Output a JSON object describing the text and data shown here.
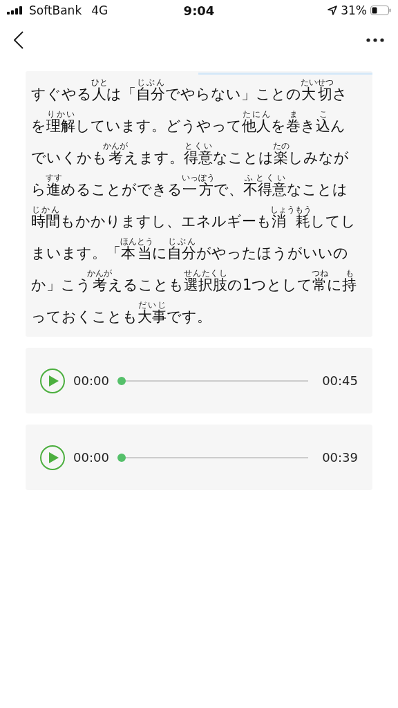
{
  "status_bar": {
    "carrier": "SoftBank",
    "network": "4G",
    "time": "9:04",
    "battery": "31%"
  },
  "passage": {
    "lines": [
      [
        {
          "text": "すぐやる"
        },
        {
          "text": "人",
          "ruby": "ひと"
        },
        {
          "text": "は「"
        },
        {
          "text": "自分",
          "ruby": "じぶん"
        },
        {
          "text": "でやらない」ことの"
        },
        {
          "text": "大切",
          "ruby": "たいせつ"
        },
        {
          "text": "さ"
        }
      ],
      [
        {
          "text": "を"
        },
        {
          "text": "理解",
          "ruby": "りかい"
        },
        {
          "text": "しています。どうやって"
        },
        {
          "text": "他人",
          "ruby": "たにん"
        },
        {
          "text": "を"
        },
        {
          "text": "巻",
          "ruby": "ま"
        },
        {
          "text": "き"
        },
        {
          "text": "込",
          "ruby": "こ"
        },
        {
          "text": "ん"
        }
      ],
      [
        {
          "text": "でいくかも"
        },
        {
          "text": "考",
          "ruby": "かんが"
        },
        {
          "text": "えます。"
        },
        {
          "text": "得意",
          "ruby": "とくい"
        },
        {
          "text": "なことは"
        },
        {
          "text": "楽",
          "ruby": "たの"
        },
        {
          "text": "しみなが"
        }
      ],
      [
        {
          "text": "ら"
        },
        {
          "text": "進",
          "ruby": "すす"
        },
        {
          "text": "めることができる"
        },
        {
          "text": "一方",
          "ruby": "いっぽう"
        },
        {
          "text": "で、"
        },
        {
          "text": "不得意",
          "ruby": "ふとくい"
        },
        {
          "text": "なことは"
        }
      ],
      [
        {
          "text": "時間",
          "ruby": "じかん"
        },
        {
          "text": "もかかりますし、エネルギーも"
        },
        {
          "text": "消 耗",
          "ruby": "しょうもう"
        },
        {
          "text": "してし"
        }
      ],
      [
        {
          "text": "まいます。「"
        },
        {
          "text": "本当",
          "ruby": "ほんとう"
        },
        {
          "text": "に"
        },
        {
          "text": "自分",
          "ruby": "じぶん"
        },
        {
          "text": "がやったほうがいいの"
        }
      ],
      [
        {
          "text": "か」こう"
        },
        {
          "text": "考",
          "ruby": "かんが"
        },
        {
          "text": "えることも"
        },
        {
          "text": "選択肢",
          "ruby": "せんたくし"
        },
        {
          "text": "の1つとして"
        },
        {
          "text": "常",
          "ruby": "つね"
        },
        {
          "text": "に"
        },
        {
          "text": "持",
          "ruby": "も"
        }
      ],
      [
        {
          "text": "っておくことも"
        },
        {
          "text": "大事",
          "ruby": "だいじ"
        },
        {
          "text": "です。"
        }
      ]
    ]
  },
  "players": [
    {
      "current": "00:00",
      "duration": "00:45",
      "level": 0
    },
    {
      "current": "00:00",
      "duration": "00:39",
      "level": 0
    }
  ]
}
